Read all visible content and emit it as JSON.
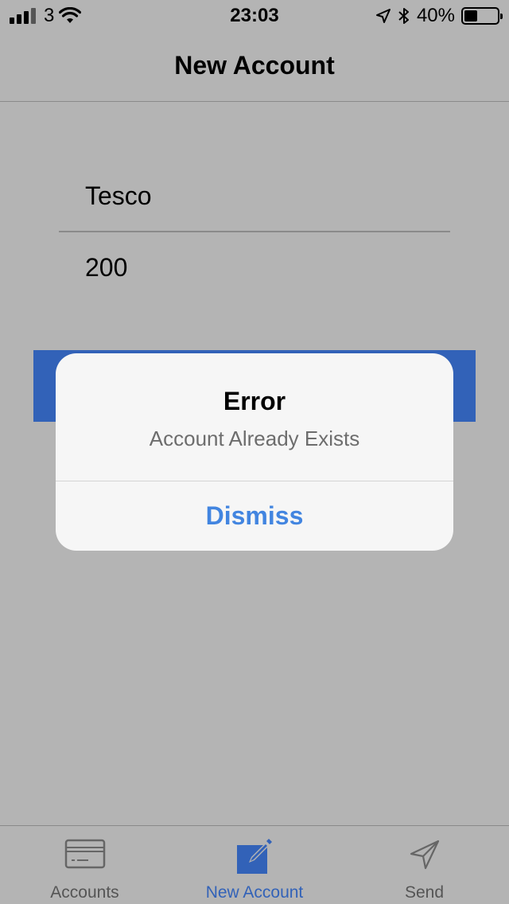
{
  "status_bar": {
    "carrier": "3",
    "time": "23:03",
    "battery": "40%",
    "battery_level": 0.4
  },
  "nav": {
    "title": "New Account"
  },
  "form": {
    "name_value": "Tesco",
    "amount_value": "200"
  },
  "alert": {
    "title": "Error",
    "message": "Account Already Exists",
    "action_label": "Dismiss"
  },
  "tabs": [
    {
      "label": "Accounts",
      "icon": "card-icon"
    },
    {
      "label": "New Account",
      "icon": "compose-icon"
    },
    {
      "label": "Send",
      "icon": "send-icon"
    }
  ],
  "colors": {
    "accent": "#3262b8",
    "alert_action": "#4285e0",
    "overlay_background": "#b4b4b4"
  }
}
